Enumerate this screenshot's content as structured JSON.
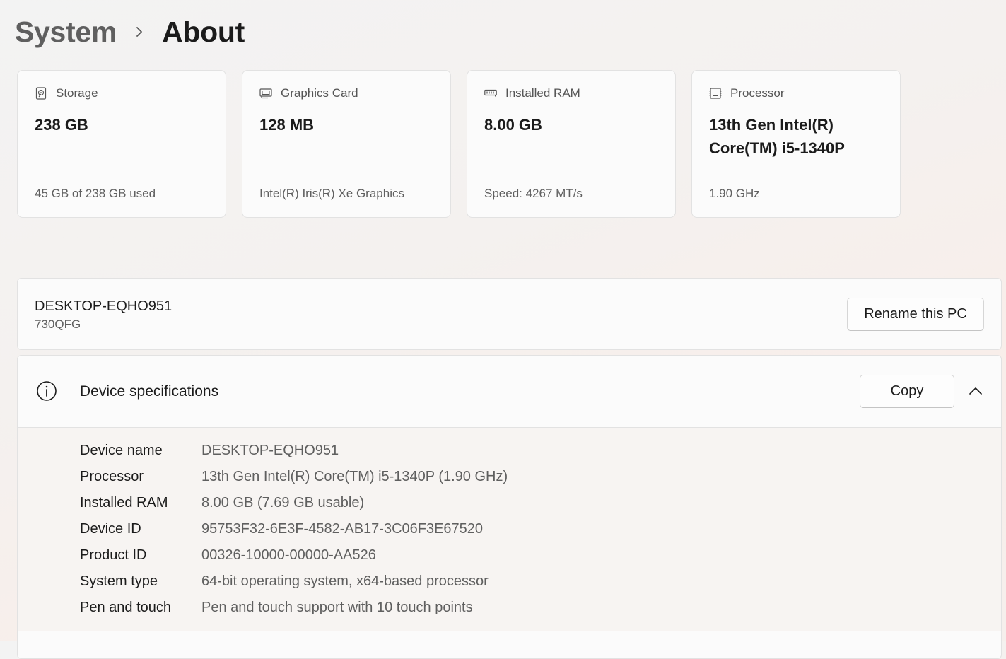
{
  "breadcrumb": {
    "parent": "System",
    "separator_icon": "chevron-right-icon",
    "current": "About"
  },
  "cards": [
    {
      "icon": "hard-drive-icon",
      "label": "Storage",
      "value": "238 GB",
      "sub": "45 GB of 238 GB used"
    },
    {
      "icon": "graphics-card-icon",
      "label": "Graphics Card",
      "value": "128 MB",
      "sub": "Intel(R) Iris(R) Xe Graphics"
    },
    {
      "icon": "ram-icon",
      "label": "Installed RAM",
      "value": "8.00 GB",
      "sub": "Speed: 4267 MT/s"
    },
    {
      "icon": "processor-icon",
      "label": "Processor",
      "value": "13th Gen Intel(R) Core(TM) i5-1340P",
      "sub": "1.90 GHz"
    }
  ],
  "pc": {
    "name": "DESKTOP-EQHO951",
    "model": "730QFG",
    "rename_label": "Rename this PC"
  },
  "device_specs": {
    "title": "Device specifications",
    "icon": "info-icon",
    "copy_label": "Copy",
    "collapse_icon": "chevron-up-icon",
    "rows": [
      {
        "label": "Device name",
        "value": "DESKTOP-EQHO951"
      },
      {
        "label": "Processor",
        "value": "13th Gen Intel(R) Core(TM) i5-1340P (1.90 GHz)"
      },
      {
        "label": "Installed RAM",
        "value": "8.00 GB (7.69 GB usable)"
      },
      {
        "label": "Device ID",
        "value": "95753F32-6E3F-4582-AB17-3C06F3E67520"
      },
      {
        "label": "Product ID",
        "value": "00326-10000-00000-AA526"
      },
      {
        "label": "System type",
        "value": "64-bit operating system, x64-based processor"
      },
      {
        "label": "Pen and touch",
        "value": "Pen and touch support with 10 touch points"
      }
    ]
  }
}
